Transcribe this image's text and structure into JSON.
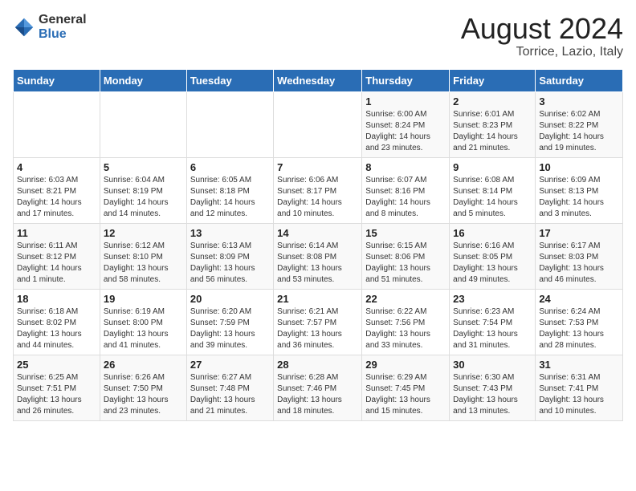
{
  "header": {
    "logo_general": "General",
    "logo_blue": "Blue",
    "month_year": "August 2024",
    "location": "Torrice, Lazio, Italy"
  },
  "weekdays": [
    "Sunday",
    "Monday",
    "Tuesday",
    "Wednesday",
    "Thursday",
    "Friday",
    "Saturday"
  ],
  "weeks": [
    [
      {
        "day": "",
        "info": ""
      },
      {
        "day": "",
        "info": ""
      },
      {
        "day": "",
        "info": ""
      },
      {
        "day": "",
        "info": ""
      },
      {
        "day": "1",
        "info": "Sunrise: 6:00 AM\nSunset: 8:24 PM\nDaylight: 14 hours\nand 23 minutes."
      },
      {
        "day": "2",
        "info": "Sunrise: 6:01 AM\nSunset: 8:23 PM\nDaylight: 14 hours\nand 21 minutes."
      },
      {
        "day": "3",
        "info": "Sunrise: 6:02 AM\nSunset: 8:22 PM\nDaylight: 14 hours\nand 19 minutes."
      }
    ],
    [
      {
        "day": "4",
        "info": "Sunrise: 6:03 AM\nSunset: 8:21 PM\nDaylight: 14 hours\nand 17 minutes."
      },
      {
        "day": "5",
        "info": "Sunrise: 6:04 AM\nSunset: 8:19 PM\nDaylight: 14 hours\nand 14 minutes."
      },
      {
        "day": "6",
        "info": "Sunrise: 6:05 AM\nSunset: 8:18 PM\nDaylight: 14 hours\nand 12 minutes."
      },
      {
        "day": "7",
        "info": "Sunrise: 6:06 AM\nSunset: 8:17 PM\nDaylight: 14 hours\nand 10 minutes."
      },
      {
        "day": "8",
        "info": "Sunrise: 6:07 AM\nSunset: 8:16 PM\nDaylight: 14 hours\nand 8 minutes."
      },
      {
        "day": "9",
        "info": "Sunrise: 6:08 AM\nSunset: 8:14 PM\nDaylight: 14 hours\nand 5 minutes."
      },
      {
        "day": "10",
        "info": "Sunrise: 6:09 AM\nSunset: 8:13 PM\nDaylight: 14 hours\nand 3 minutes."
      }
    ],
    [
      {
        "day": "11",
        "info": "Sunrise: 6:11 AM\nSunset: 8:12 PM\nDaylight: 14 hours\nand 1 minute."
      },
      {
        "day": "12",
        "info": "Sunrise: 6:12 AM\nSunset: 8:10 PM\nDaylight: 13 hours\nand 58 minutes."
      },
      {
        "day": "13",
        "info": "Sunrise: 6:13 AM\nSunset: 8:09 PM\nDaylight: 13 hours\nand 56 minutes."
      },
      {
        "day": "14",
        "info": "Sunrise: 6:14 AM\nSunset: 8:08 PM\nDaylight: 13 hours\nand 53 minutes."
      },
      {
        "day": "15",
        "info": "Sunrise: 6:15 AM\nSunset: 8:06 PM\nDaylight: 13 hours\nand 51 minutes."
      },
      {
        "day": "16",
        "info": "Sunrise: 6:16 AM\nSunset: 8:05 PM\nDaylight: 13 hours\nand 49 minutes."
      },
      {
        "day": "17",
        "info": "Sunrise: 6:17 AM\nSunset: 8:03 PM\nDaylight: 13 hours\nand 46 minutes."
      }
    ],
    [
      {
        "day": "18",
        "info": "Sunrise: 6:18 AM\nSunset: 8:02 PM\nDaylight: 13 hours\nand 44 minutes."
      },
      {
        "day": "19",
        "info": "Sunrise: 6:19 AM\nSunset: 8:00 PM\nDaylight: 13 hours\nand 41 minutes."
      },
      {
        "day": "20",
        "info": "Sunrise: 6:20 AM\nSunset: 7:59 PM\nDaylight: 13 hours\nand 39 minutes."
      },
      {
        "day": "21",
        "info": "Sunrise: 6:21 AM\nSunset: 7:57 PM\nDaylight: 13 hours\nand 36 minutes."
      },
      {
        "day": "22",
        "info": "Sunrise: 6:22 AM\nSunset: 7:56 PM\nDaylight: 13 hours\nand 33 minutes."
      },
      {
        "day": "23",
        "info": "Sunrise: 6:23 AM\nSunset: 7:54 PM\nDaylight: 13 hours\nand 31 minutes."
      },
      {
        "day": "24",
        "info": "Sunrise: 6:24 AM\nSunset: 7:53 PM\nDaylight: 13 hours\nand 28 minutes."
      }
    ],
    [
      {
        "day": "25",
        "info": "Sunrise: 6:25 AM\nSunset: 7:51 PM\nDaylight: 13 hours\nand 26 minutes."
      },
      {
        "day": "26",
        "info": "Sunrise: 6:26 AM\nSunset: 7:50 PM\nDaylight: 13 hours\nand 23 minutes."
      },
      {
        "day": "27",
        "info": "Sunrise: 6:27 AM\nSunset: 7:48 PM\nDaylight: 13 hours\nand 21 minutes."
      },
      {
        "day": "28",
        "info": "Sunrise: 6:28 AM\nSunset: 7:46 PM\nDaylight: 13 hours\nand 18 minutes."
      },
      {
        "day": "29",
        "info": "Sunrise: 6:29 AM\nSunset: 7:45 PM\nDaylight: 13 hours\nand 15 minutes."
      },
      {
        "day": "30",
        "info": "Sunrise: 6:30 AM\nSunset: 7:43 PM\nDaylight: 13 hours\nand 13 minutes."
      },
      {
        "day": "31",
        "info": "Sunrise: 6:31 AM\nSunset: 7:41 PM\nDaylight: 13 hours\nand 10 minutes."
      }
    ]
  ]
}
